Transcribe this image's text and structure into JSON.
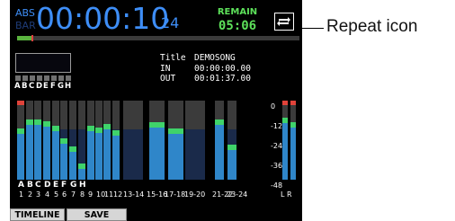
{
  "counter": {
    "mode_abs": "ABS",
    "mode_bar": "BAR",
    "time": "00:00:10",
    "frames": "24"
  },
  "remain": {
    "label": "REMAIN",
    "value": "05:06"
  },
  "repeat": {
    "icon": "repeat-icon"
  },
  "progress": {
    "fraction": 0.05
  },
  "song": {
    "title_label": "Title",
    "title": "DEMOSONG",
    "in_label": "IN",
    "in_time": "00:00:00.00",
    "out_label": "OUT",
    "out_time": "00:01:37.00"
  },
  "input_letters": [
    "A",
    "B",
    "C",
    "D",
    "E",
    "F",
    "G",
    "H"
  ],
  "meter_scale": [
    "0",
    "-12",
    "-24",
    "-36",
    "-48"
  ],
  "channels": [
    {
      "label": "1",
      "level": 0.62,
      "src": "A"
    },
    {
      "label": "2",
      "level": 0.74,
      "src": "B"
    },
    {
      "label": "3",
      "level": 0.74,
      "src": "C"
    },
    {
      "label": "4",
      "level": 0.72,
      "src": "D"
    },
    {
      "label": "5",
      "level": 0.66,
      "src": "E"
    },
    {
      "label": "6",
      "level": 0.5,
      "src": "F"
    },
    {
      "label": "7",
      "level": 0.4,
      "src": "G"
    },
    {
      "label": "8",
      "level": 0.18,
      "src": "H"
    },
    {
      "label": "9",
      "level": 0.66,
      "src": ""
    },
    {
      "label": "10",
      "level": 0.64,
      "src": ""
    },
    {
      "label": "11",
      "level": 0.68,
      "src": ""
    },
    {
      "label": "12",
      "level": 0.6,
      "src": ""
    },
    {
      "label": "13-14",
      "level": 0.0,
      "src": ""
    },
    {
      "label": "15-16",
      "level": 0.7,
      "src": ""
    },
    {
      "label": "17-18",
      "level": 0.62,
      "src": ""
    },
    {
      "label": "19-20",
      "level": 0.0,
      "src": ""
    },
    {
      "label": "21-22",
      "level": 0.74,
      "src": ""
    },
    {
      "label": "23-24",
      "level": 0.42,
      "src": ""
    }
  ],
  "master": {
    "label": "L R",
    "left": 0.76,
    "right": 0.7
  },
  "tabs": {
    "timeline": "TIMELINE",
    "save": "SAVE"
  },
  "callout": {
    "text": "Repeat icon"
  },
  "colors": {
    "meter_blue": "#2f86c9",
    "meter_peak": "#3fd36a",
    "meter_clip": "#e0433a",
    "counter_blue": "#3e8ef7",
    "remain_green": "#5de05a"
  }
}
